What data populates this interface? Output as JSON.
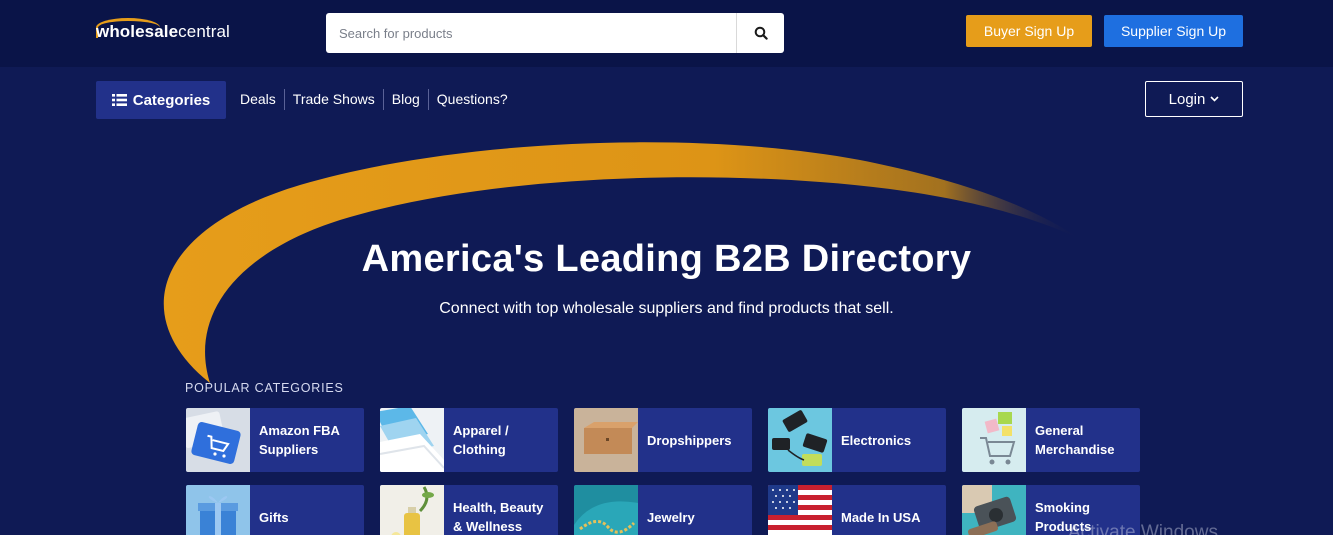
{
  "header": {
    "logo_bold": "wholesale",
    "logo_light": "central",
    "search_placeholder": "Search for products",
    "buyer_signup": "Buyer Sign Up",
    "supplier_signup": "Supplier Sign Up"
  },
  "nav": {
    "categories_label": "Categories",
    "links": [
      "Deals",
      "Trade Shows",
      "Blog",
      "Questions?"
    ],
    "login_label": "Login"
  },
  "hero": {
    "title": "America's Leading B2B Directory",
    "subtitle": "Connect with top wholesale suppliers and find products that sell."
  },
  "popular": {
    "label": "POPULAR CATEGORIES",
    "categories": [
      {
        "label": "Amazon FBA Suppliers",
        "icon": "amazon-cart-keyboard"
      },
      {
        "label": "Apparel / Clothing",
        "icon": "folded-clothing"
      },
      {
        "label": "Dropshippers",
        "icon": "cardboard-box"
      },
      {
        "label": "Electronics",
        "icon": "power-banks"
      },
      {
        "label": "General Merchandise",
        "icon": "shopping-cart-gifts"
      },
      {
        "label": "Gifts",
        "icon": "gift-box"
      },
      {
        "label": "Health, Beauty & Wellness",
        "icon": "beauty-oil-bottle"
      },
      {
        "label": "Jewelry",
        "icon": "gold-chain"
      },
      {
        "label": "Made In USA",
        "icon": "us-flag"
      },
      {
        "label": "Smoking Products",
        "icon": "smoking-device"
      }
    ]
  },
  "colors": {
    "page_bg": "#0f1a55",
    "topbar_bg": "#0a1448",
    "card_bg": "#22318a",
    "accent_orange": "#e69d1a",
    "accent_blue": "#1e6fe0"
  },
  "watermark": "Activate Windows"
}
